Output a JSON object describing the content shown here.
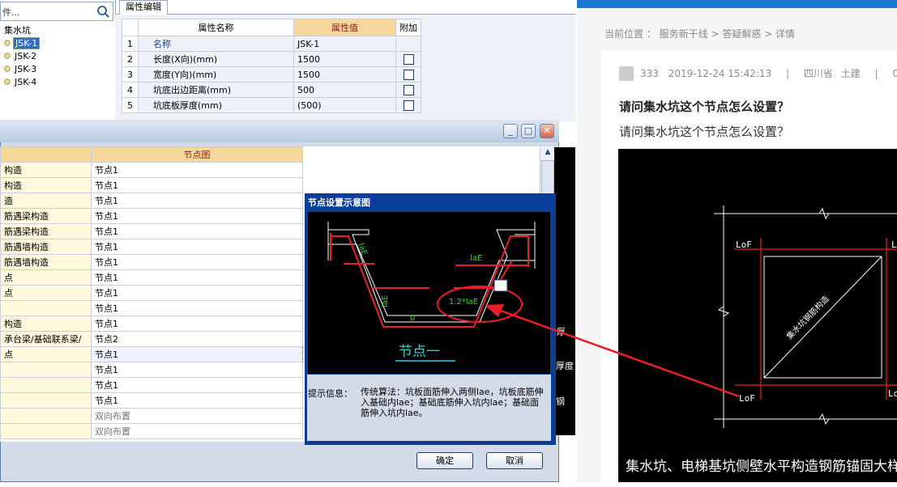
{
  "tree": {
    "search_text": "件...",
    "root": "集水坑",
    "items": [
      "JSK-1",
      "JSK-2",
      "JSK-3",
      "JSK-4"
    ]
  },
  "prop_editor": {
    "tab": "属性编辑",
    "headers": {
      "name": "属性名称",
      "value": "属性值",
      "extra": "附加"
    },
    "rows": [
      {
        "num": "1",
        "name": "名称",
        "value": "JSK-1"
      },
      {
        "num": "2",
        "name": "长度(X向)(mm)",
        "value": "1500"
      },
      {
        "num": "3",
        "name": "宽度(Y向)(mm)",
        "value": "1500"
      },
      {
        "num": "4",
        "name": "坑底出边距离(mm)",
        "value": "500"
      },
      {
        "num": "5",
        "name": "坑底板厚度(mm)",
        "value": "(500)"
      }
    ]
  },
  "dialog": {
    "header_col2": "节点图",
    "rows": [
      {
        "left": "构造",
        "right": "节点1"
      },
      {
        "left": "构造",
        "right": "节点1"
      },
      {
        "left": "造",
        "right": "节点1"
      },
      {
        "left": "筋遇梁构造",
        "right": "节点1"
      },
      {
        "left": "筋遇梁构造",
        "right": "节点1"
      },
      {
        "left": "筋遇墙构造",
        "right": "节点1"
      },
      {
        "left": "筋遇墙构造",
        "right": "节点1"
      },
      {
        "left": "点",
        "right": "节点1"
      },
      {
        "left": "点",
        "right": "节点1"
      },
      {
        "left": "",
        "right": "节点1"
      },
      {
        "left": "构造",
        "right": "节点1"
      },
      {
        "left": "承台梁/基础联系梁/",
        "right": "节点2"
      },
      {
        "left": "点",
        "right": "节点1"
      },
      {
        "left": "",
        "right": "节点1"
      },
      {
        "left": "",
        "right": "节点1"
      },
      {
        "left": "",
        "right": "节点1"
      },
      {
        "left": "",
        "right": "双向布置"
      },
      {
        "left": "",
        "right": "双向布置"
      }
    ],
    "ok_label": "确定",
    "cancel_label": "取消"
  },
  "popup": {
    "title": "节点设置示意图",
    "diagram_caption": "节点一",
    "labels": {
      "lae1": "laE",
      "lae2": "laE",
      "lae3": "laE",
      "factor": "1.2*laE",
      "zero": "0"
    },
    "info_label": "提示信息：",
    "info_text": "传统算法：坑板面筋伸入两侧lae，坑板底筋伸入基础内lae；基础底筋伸入坑内lae；基础面筋伸入坑内lae。"
  },
  "strip_labels": [
    "厚",
    "厚度",
    "钢"
  ],
  "page": {
    "breadcrumb": "当前位置 ： 服务新干线 > 答疑解惑 > 详情",
    "user": "333",
    "datetime": "2019-12-24 15:42:13",
    "sep": "|",
    "location": "四川省",
    "category": "土建",
    "views": "0查",
    "question_title": "请问集水坑这个节点怎么设置？",
    "question_body": "请问集水坑这个节点怎么设置？",
    "cad": {
      "lof_top_left": "LoF",
      "lof_top_right": "L",
      "lof_bottom_left": "LoF",
      "lof_bottom_right": "Lo",
      "diag_label": "集水坑钢筋构造",
      "caption": "集水坑、电梯基坑侧壁水平构造钢筋锚固大样"
    }
  },
  "colors": {
    "annotation_red": "#e8202a",
    "tree_select": "#316ac5",
    "header_orange": "#f6d79b",
    "cad_green": "#35d135"
  }
}
